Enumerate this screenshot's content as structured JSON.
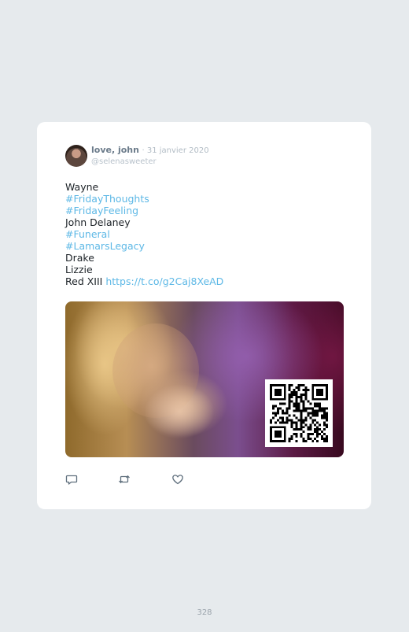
{
  "tweet": {
    "author_name": "love, john",
    "date": "· 31 janvier 2020",
    "handle": "@selenasweeter",
    "lines": [
      {
        "text": "Wayne",
        "kind": "text"
      },
      {
        "text": "#FridayThoughts",
        "kind": "tag"
      },
      {
        "text": "#FridayFeeling",
        "kind": "tag"
      },
      {
        "text": "John Delaney",
        "kind": "text"
      },
      {
        "text": "#Funeral",
        "kind": "tag"
      },
      {
        "text": "#LamarsLegacy",
        "kind": "tag"
      },
      {
        "text": "Drake",
        "kind": "text"
      },
      {
        "text": "Lizzie",
        "kind": "text"
      }
    ],
    "last_line": {
      "text": "Red XIII ",
      "link": "https://t.co/g2Caj8XeAD"
    },
    "media": {
      "qr_code": "qr-code"
    },
    "actions": [
      {
        "name": "reply",
        "icon": "reply-icon"
      },
      {
        "name": "retweet",
        "icon": "retweet-icon"
      },
      {
        "name": "like",
        "icon": "heart-icon"
      }
    ]
  },
  "page_number": "328",
  "colors": {
    "background": "#e6eaed",
    "card": "#ffffff",
    "link": "#5db8e6",
    "name": "#6b7b8a",
    "muted": "#b2bcc5",
    "icon": "#5f6f7d"
  }
}
